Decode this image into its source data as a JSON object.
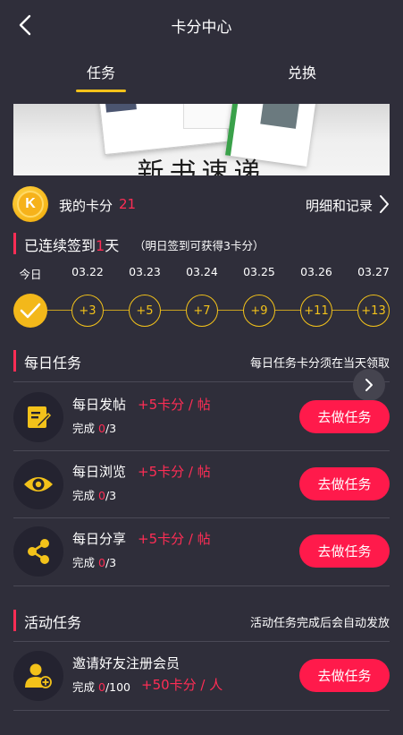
{
  "header": {
    "title": "卡分中心",
    "back_icon": "back-arrow-icon"
  },
  "tabs": [
    {
      "label": "任务",
      "active": true
    },
    {
      "label": "兑换",
      "active": false
    }
  ],
  "banner": {
    "text": "新书速递"
  },
  "points": {
    "label": "我的卡分",
    "value": "21",
    "detail_label": "明细和记录"
  },
  "signin": {
    "prefix": "已连续签到",
    "days": "1",
    "suffix": "天",
    "note": "（明日签到可获得3卡分）",
    "dates": [
      "今日",
      "03.22",
      "03.23",
      "03.24",
      "03.25",
      "03.26",
      "03.27"
    ],
    "rewards": [
      "",
      "+3",
      "+5",
      "+7",
      "+9",
      "+11",
      "+13"
    ]
  },
  "daily": {
    "title": "每日任务",
    "note": "每日任务卡分须在当天领取",
    "tasks": [
      {
        "name": "每日发帖",
        "reward": "+5卡分 / 帖",
        "progress_label": "完成 ",
        "done": "0",
        "total": "/3",
        "button": "去做任务",
        "icon": "edit-note-icon"
      },
      {
        "name": "每日浏览",
        "reward": "+5卡分 / 帖",
        "progress_label": "完成 ",
        "done": "0",
        "total": "/3",
        "button": "去做任务",
        "icon": "eye-icon"
      },
      {
        "name": "每日分享",
        "reward": "+5卡分 / 帖",
        "progress_label": "完成 ",
        "done": "0",
        "total": "/3",
        "button": "去做任务",
        "icon": "share-icon"
      }
    ]
  },
  "activity": {
    "title": "活动任务",
    "note": "活动任务完成后会自动发放",
    "tasks": [
      {
        "name": "邀请好友注册会员",
        "reward": "+50卡分 / 人",
        "progress_label": "完成 ",
        "done": "0",
        "total": "/100",
        "button": "去做任务",
        "icon": "add-user-icon"
      }
    ]
  },
  "colors": {
    "accent": "#f3c21a",
    "highlight": "#ff2d55",
    "button": "#ff1a4b",
    "background": "#2f2e3a"
  }
}
